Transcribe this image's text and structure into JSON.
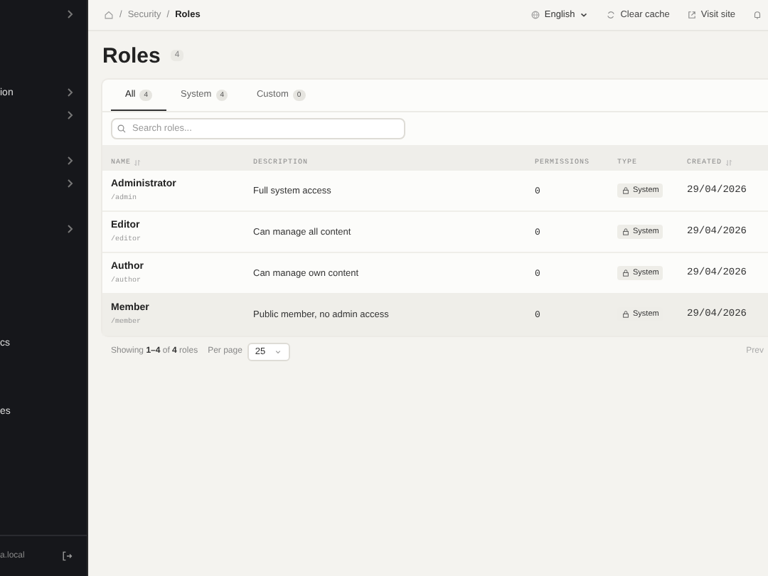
{
  "sidebar": {
    "sections": [
      {
        "items": [
          {
            "kind": "expandable"
          }
        ]
      },
      {
        "items": [
          {
            "kind": "expandable",
            "label": "ion"
          },
          {
            "kind": "expandable"
          },
          {
            "kind": "blank"
          },
          {
            "kind": "expandable"
          },
          {
            "kind": "expandable"
          },
          {
            "kind": "blank"
          },
          {
            "kind": "expandable"
          },
          {
            "kind": "blank"
          },
          {
            "kind": "blank"
          },
          {
            "kind": "blank"
          },
          {
            "kind": "blank"
          },
          {
            "kind": "text",
            "label": "cs"
          },
          {
            "kind": "blank"
          },
          {
            "kind": "blank"
          },
          {
            "kind": "text",
            "label": "es"
          }
        ]
      }
    ],
    "footer": {
      "user": "a.local"
    }
  },
  "breadcrumb": {
    "separator": "/",
    "items": [
      "Security",
      "Roles"
    ]
  },
  "topbar": {
    "language": "English",
    "actions": [
      {
        "kind": "refresh",
        "label": "Clear cache"
      },
      {
        "kind": "external",
        "label": "Visit site"
      }
    ]
  },
  "page": {
    "title": "Roles",
    "count": "4"
  },
  "tabs": [
    {
      "label": "All",
      "count": "4",
      "selected": true
    },
    {
      "label": "System",
      "count": "4",
      "selected": false
    },
    {
      "label": "Custom",
      "count": "0",
      "selected": false
    }
  ],
  "search": {
    "placeholder": "Search roles..."
  },
  "table": {
    "columns": [
      {
        "label": "NAME",
        "sortable": true
      },
      {
        "label": "DESCRIPTION",
        "sortable": false
      },
      {
        "label": "PERMISSIONS",
        "sortable": false
      },
      {
        "label": "TYPE",
        "sortable": false
      },
      {
        "label": "CREATED",
        "sortable": true
      }
    ],
    "rows": [
      {
        "name": "Administrator",
        "slug": "/admin",
        "description": "Full system access",
        "permissions": "0",
        "type": "System",
        "created": "29/04/2026",
        "highlighted": false
      },
      {
        "name": "Editor",
        "slug": "/editor",
        "description": "Can manage all content",
        "permissions": "0",
        "type": "System",
        "created": "29/04/2026",
        "highlighted": false
      },
      {
        "name": "Author",
        "slug": "/author",
        "description": "Can manage own content",
        "permissions": "0",
        "type": "System",
        "created": "29/04/2026",
        "highlighted": false
      },
      {
        "name": "Member",
        "slug": "/member",
        "description": "Public member, no admin access",
        "permissions": "0",
        "type": "System",
        "created": "29/04/2026",
        "highlighted": true
      }
    ]
  },
  "pagination": {
    "summary": "Showing **1–4** of **4** roles",
    "per_page_label": "Per page",
    "per_page": "25",
    "prev": "Prev"
  }
}
